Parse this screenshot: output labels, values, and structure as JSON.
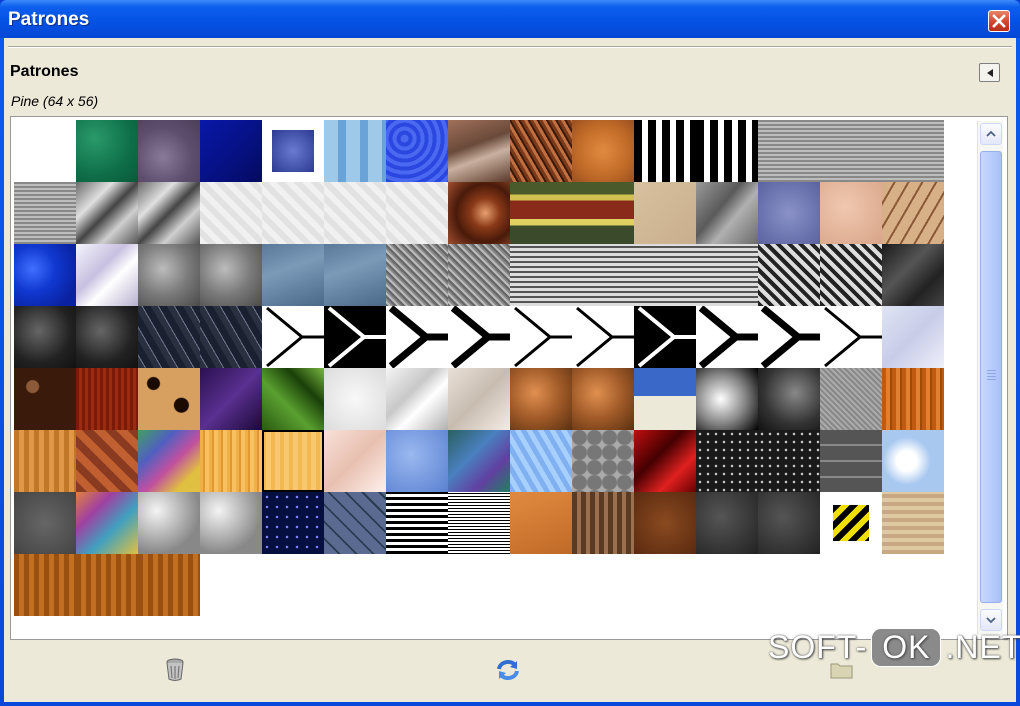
{
  "window": {
    "title": "Patrones",
    "close_icon": "close-icon"
  },
  "dock": {
    "heading": "Patrones",
    "menu_icon": "tab-menu-icon",
    "selected_pattern": "Pine (64 x 56)"
  },
  "colors": {
    "title_bar": "#0551e3",
    "panel_bg": "#ece9d8",
    "grid_bg": "#ffffff",
    "selection": "#000000"
  },
  "patterns": {
    "selected_index": 79,
    "rows": [
      [
        "white",
        "green-felt",
        "purple-marble",
        "blue-gradient",
        "blue-square",
        "light-blue-tiles",
        "blue-web",
        "rock-rust",
        "brown-straw",
        "orange-rust",
        "black-white-blot",
        "black-white-blot",
        "burlap",
        "burlap",
        "burlap"
      ],
      [
        "burlap",
        "gray-crinkle",
        "gray-crinkle",
        "white-pattern",
        "white-pattern",
        "white-pattern",
        "white-pattern",
        "brown-swirl",
        "yellow-ribbon",
        "yellow-ribbon",
        "beige-sand",
        "gray-stone-cracked",
        "blue-gray",
        "peach",
        "cracked-clay"
      ],
      [
        "blue-water",
        "white-crinkle",
        "gray-gravel",
        "gray-gravel",
        "slate-blue",
        "slate-blue",
        "gray-noise",
        "gray-noise",
        "knit-gray",
        "knit-gray",
        "knit-gray",
        "knit-gray",
        "houndstooth",
        "houndstooth",
        "dark-marble"
      ],
      [
        "dark-stone",
        "dark-stone",
        "dark-crack",
        "dark-crack",
        "arrow-thin",
        "arrow-black",
        "arrow-thick",
        "arrow-thick",
        "arrow-thin",
        "arrow-thin",
        "arrow-black",
        "arrow-thick",
        "arrow-thick",
        "arrow-thin",
        "light-fog"
      ],
      [
        "coffee-beans",
        "red-wood",
        "leopard",
        "purple-lightning",
        "green-leaves",
        "white-paper",
        "white-marble",
        "beige-marble",
        "orange-pebbles",
        "orange-pebbles",
        "screenshot-tile",
        "gray-blur",
        "dark-fog",
        "metal-scratch",
        "wood-orange"
      ],
      [
        "wood-oak",
        "parquet",
        "rainbow-swirl",
        "pine",
        "pine-light",
        "pink-marble",
        "blue-water-light",
        "3d-cubes",
        "blue-streaks",
        "gray-circles",
        "red-abstract",
        "black-starry",
        "black-starry",
        "stone-wall",
        "sky-clouds"
      ],
      [
        "gray-cement",
        "colorful-blocks",
        "gray-fade",
        "gray-fade",
        "night-sky",
        "blue-stones",
        "black-lines",
        "black-lines-thin",
        "orange-crack",
        "tree-bark",
        "brown-rust",
        "dark-granite",
        "dark-granite",
        "yellow-stripes",
        "beige-wood"
      ],
      [
        "wood-walnut",
        "wood-walnut",
        "wood-walnut"
      ]
    ]
  },
  "bottom_icons": [
    "trash-icon",
    "refresh-icon",
    "folder-icon"
  ],
  "watermark": {
    "left": "SOFT-",
    "ok": "OK",
    "right": ".NET"
  }
}
